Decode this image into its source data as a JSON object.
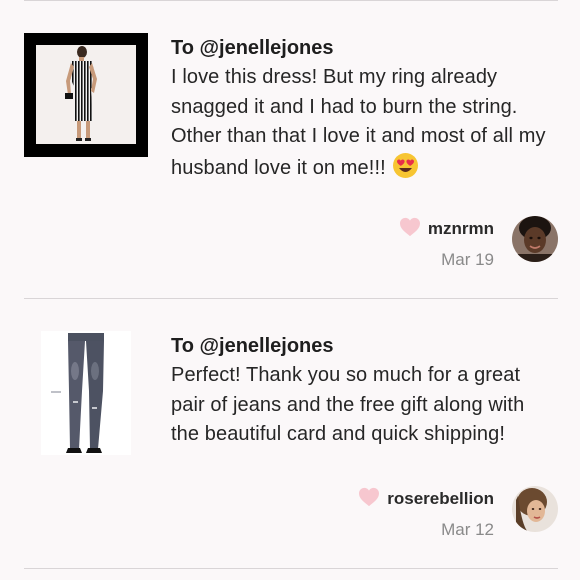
{
  "reviews": [
    {
      "to": "To @jenellejones",
      "comment": "I love this dress! But my ring already snagged it and I had to burn the string. Other than that I love it and most of all my husband love it on me!!!",
      "emoji": "heart-eyes-emoji",
      "username": "mznrmn",
      "date": "Mar 19",
      "product": "striped-dress-photo"
    },
    {
      "to": "To @jenellejones",
      "comment": "Perfect! Thank you so much for a great pair of jeans and the free gift along with the beautiful card and quick shipping!",
      "username": "roserebellion",
      "date": "Mar 12",
      "product": "skinny-jeans-photo"
    }
  ],
  "colors": {
    "background": "#fbf8f9",
    "heart": "#f7c7cf",
    "divider": "#d9d5d7",
    "date": "#8a8a8a"
  },
  "icons": [
    "heart-icon",
    "heart-eyes-emoji"
  ]
}
